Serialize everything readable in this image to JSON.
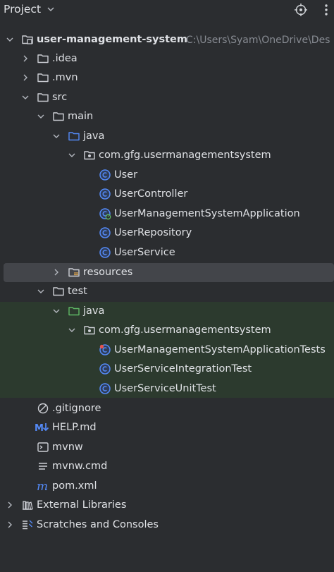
{
  "panel": {
    "title": "Project",
    "colors": {
      "background": "#2b2d30",
      "selected_row": "#43454a",
      "test_band": "#2c3a2e",
      "class_icon": "#548af7",
      "text": "#dfe1e5",
      "path_text": "#868a91"
    }
  },
  "tree": [
    {
      "label": "user-management-system",
      "path": "C:\\Users\\Syam\\OneDrive\\Des",
      "icon": "module-folder-icon",
      "expanded": true
    },
    {
      "label": ".idea",
      "icon": "folder-icon",
      "expanded": false
    },
    {
      "label": ".mvn",
      "icon": "folder-icon",
      "expanded": false
    },
    {
      "label": "src",
      "icon": "folder-icon",
      "expanded": true
    },
    {
      "label": "main",
      "icon": "folder-icon",
      "expanded": true
    },
    {
      "label": "java",
      "icon": "source-folder-icon",
      "expanded": true
    },
    {
      "label": "com.gfg.usermanagementsystem",
      "icon": "package-icon",
      "expanded": true
    },
    {
      "label": "User",
      "icon": "class-icon"
    },
    {
      "label": "UserController",
      "icon": "class-icon"
    },
    {
      "label": "UserManagementSystemApplication",
      "icon": "spring-boot-class-icon"
    },
    {
      "label": "UserRepository",
      "icon": "class-icon"
    },
    {
      "label": "UserService",
      "icon": "class-icon"
    },
    {
      "label": "resources",
      "icon": "resources-folder-icon",
      "expanded": false,
      "selected": true
    },
    {
      "label": "test",
      "icon": "folder-icon",
      "expanded": true
    },
    {
      "label": "java",
      "icon": "test-source-folder-icon",
      "expanded": true
    },
    {
      "label": "com.gfg.usermanagementsystem",
      "icon": "package-icon",
      "expanded": true
    },
    {
      "label": "UserManagementSystemApplicationTests",
      "icon": "test-class-icon"
    },
    {
      "label": "UserServiceIntegrationTest",
      "icon": "class-icon"
    },
    {
      "label": "UserServiceUnitTest",
      "icon": "class-icon"
    },
    {
      "label": ".gitignore",
      "icon": "gitignore-icon"
    },
    {
      "label": "HELP.md",
      "icon": "markdown-icon"
    },
    {
      "label": "mvnw",
      "icon": "shell-script-icon"
    },
    {
      "label": "mvnw.cmd",
      "icon": "text-file-icon"
    },
    {
      "label": "pom.xml",
      "icon": "maven-icon"
    },
    {
      "label": "External Libraries",
      "icon": "libraries-icon",
      "expanded": false
    },
    {
      "label": "Scratches and Consoles",
      "icon": "scratches-icon",
      "expanded": false
    }
  ]
}
